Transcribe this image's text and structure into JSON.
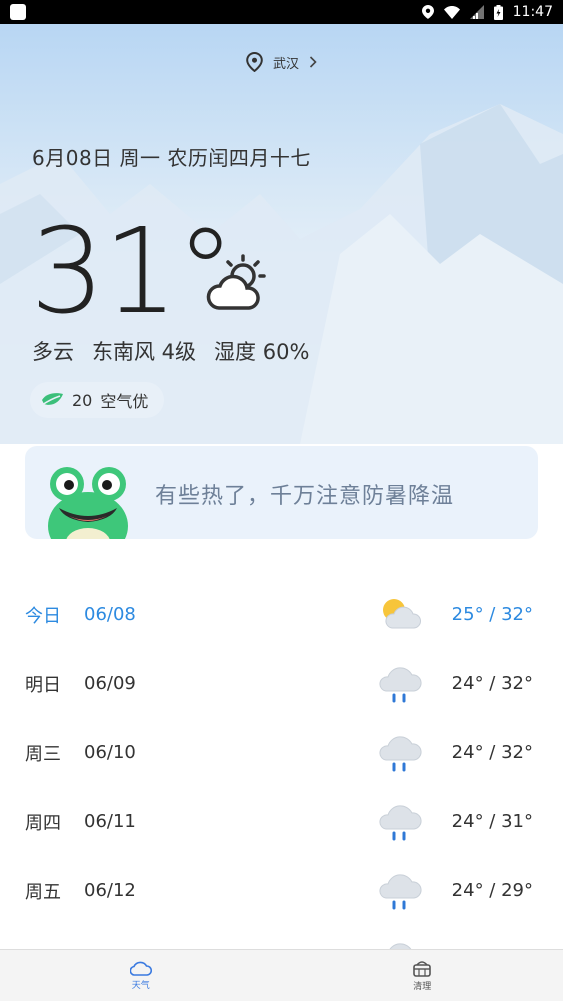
{
  "status_bar": {
    "time": "11:47"
  },
  "location": {
    "city": "武汉"
  },
  "date_line": "6月08日  周一  农历闰四月十七",
  "current": {
    "temperature": "31°",
    "condition": "多云",
    "wind": "东南风 4级",
    "humidity": "湿度 60%",
    "aqi_value": "20",
    "aqi_label": "空气优"
  },
  "tip": {
    "text": "有些热了，千万注意防暑降温"
  },
  "forecast": [
    {
      "day": "今日",
      "date": "06/08",
      "icon": "partly-cloudy-icon",
      "temp": "25° /  32°"
    },
    {
      "day": "明日",
      "date": "06/09",
      "icon": "rain-cloud-icon",
      "temp": "24° /  32°"
    },
    {
      "day": "周三",
      "date": "06/10",
      "icon": "rain-cloud-icon",
      "temp": "24° /  32°"
    },
    {
      "day": "周四",
      "date": "06/11",
      "icon": "rain-cloud-icon",
      "temp": "24° /  31°"
    },
    {
      "day": "周五",
      "date": "06/12",
      "icon": "rain-cloud-icon",
      "temp": "24° /  29°"
    }
  ],
  "tabs": [
    {
      "label": "天气",
      "icon": "cloud-icon"
    },
    {
      "label": "清理",
      "icon": "basket-icon"
    }
  ],
  "colors": {
    "accent": "#2d8ae0",
    "leaf": "#3bbf7a"
  }
}
